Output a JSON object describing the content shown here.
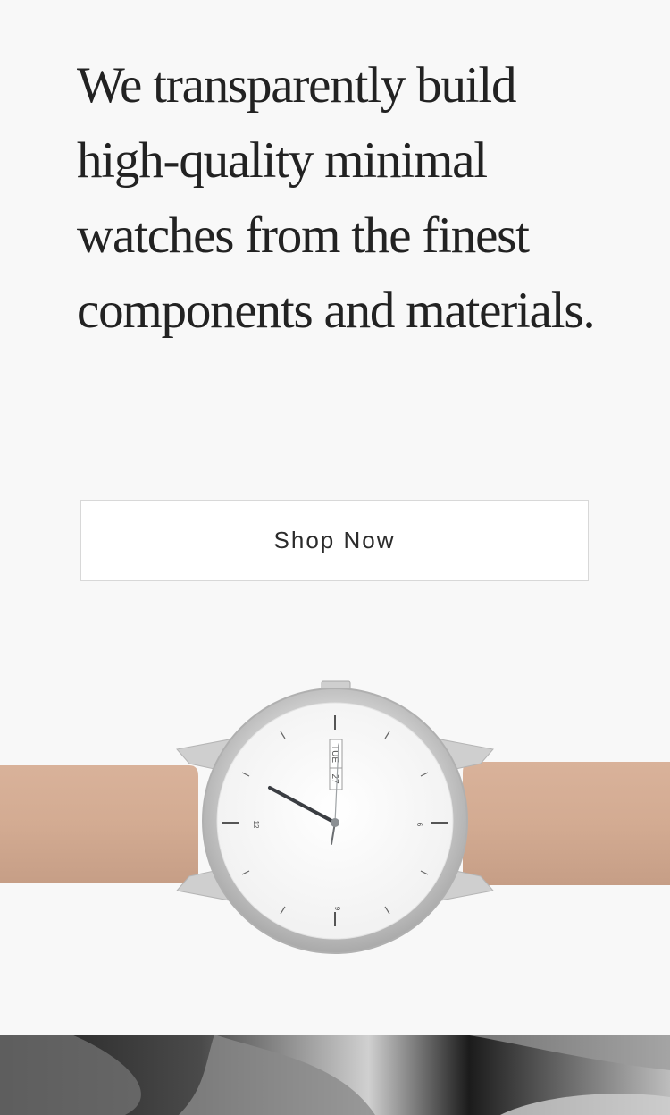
{
  "hero": {
    "headline": "We transparently build high-quality minimal watches from the finest components and materials."
  },
  "cta": {
    "label": "Shop Now"
  },
  "product": {
    "watch": {
      "date_day": "TUE",
      "date_num": "27",
      "markers": [
        "12",
        "6",
        "9"
      ],
      "strap_color": "#d5ad94",
      "case_color": "#d6d6d6",
      "dial_color": "#ffffff"
    }
  },
  "lifestyle_photo": {
    "description_icon": "hand-photo"
  }
}
